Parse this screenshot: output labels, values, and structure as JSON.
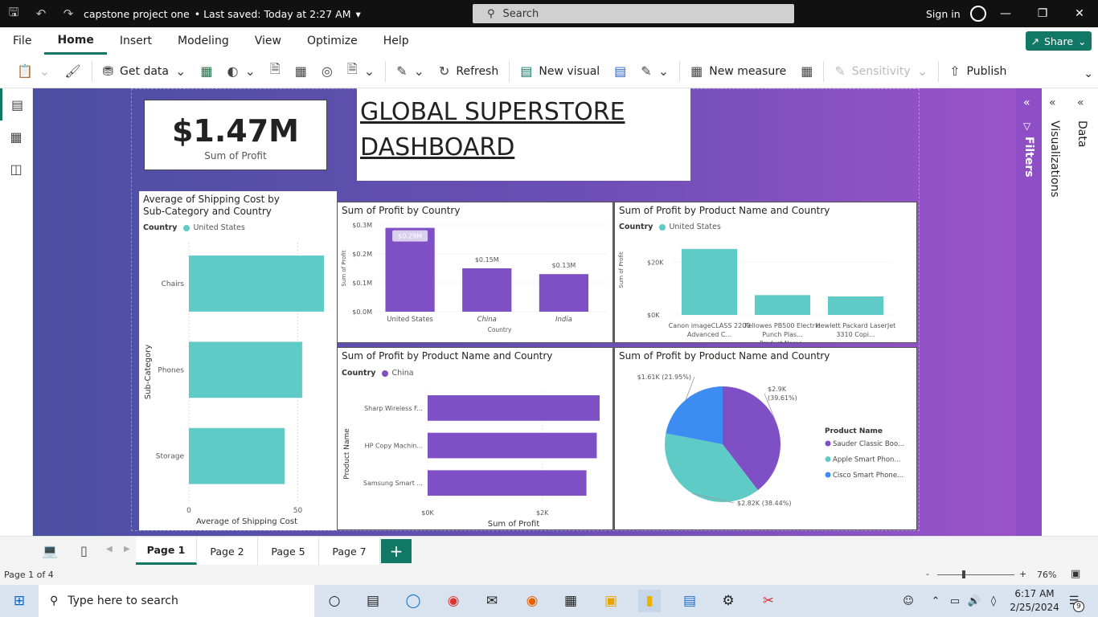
{
  "titlebar": {
    "title": "capstone project one",
    "saved": "• Last saved: Today at 2:27 AM",
    "search": "Search",
    "signin": "Sign in"
  },
  "menu": {
    "items": [
      "File",
      "Home",
      "Insert",
      "Modeling",
      "View",
      "Optimize",
      "Help"
    ],
    "share": "Share"
  },
  "ribbon": {
    "get_data": "Get data",
    "refresh": "Refresh",
    "new_visual": "New visual",
    "new_measure": "New measure",
    "sensitivity": "Sensitivity",
    "publish": "Publish"
  },
  "kpi": {
    "value": "$1.47M",
    "label": "Sum of Profit"
  },
  "dashboard_title": {
    "line1": "GLOBAL SUPERSTORE",
    "line2": "DASHBOARD"
  },
  "colors": {
    "teal": "#5ecbc7",
    "purple": "#7f4fc6",
    "blue": "#3c8cf2",
    "brand": "#117865"
  },
  "chart_data": [
    {
      "id": "shipping",
      "type": "bar",
      "orientation": "horizontal",
      "title": "Average of Shipping Cost by Sub-Category and Country",
      "legend_title": "Country",
      "series": [
        {
          "name": "United States",
          "values": [
            62,
            52,
            44
          ]
        }
      ],
      "categories": [
        "Chairs",
        "Phones",
        "Storage"
      ],
      "xlabel": "Average of Shipping Cost",
      "ylabel": "Sub-Category",
      "xticks": [
        "0",
        "50"
      ],
      "xlim": [
        0,
        62
      ]
    },
    {
      "id": "profit_country",
      "type": "bar",
      "title": "Sum of Profit by Country",
      "categories": [
        "United States",
        "China",
        "India"
      ],
      "values": [
        0.29,
        0.15,
        0.13
      ],
      "data_labels": [
        "$0.29M",
        "$0.15M",
        "$0.13M"
      ],
      "xlabel": "Country",
      "ylabel": "Sum of Profit",
      "yticks": [
        "$0.0M",
        "$0.1M",
        "$0.2M",
        "$0.3M"
      ],
      "ylim": [
        0,
        0.3
      ]
    },
    {
      "id": "profit_product_us",
      "type": "bar",
      "title": "Sum of Profit by Product Name and Country",
      "legend_title": "Country",
      "series": [
        {
          "name": "United States",
          "values": [
            25,
            7.5,
            7
          ]
        }
      ],
      "categories": [
        "Canon imageCLASS 2200 Advanced C...",
        "Fellowes PB500 Electric Punch Plas...",
        "Hewlett Packard LaserJet 3310 Copi..."
      ],
      "xlabel": "Product Name",
      "ylabel": "Sum of Profit",
      "yticks": [
        "$0K",
        "$20K"
      ],
      "ylim": [
        0,
        28
      ]
    },
    {
      "id": "profit_product_china",
      "type": "bar",
      "orientation": "horizontal",
      "title": "Sum of Profit by Product Name and Country",
      "legend_title": "Country",
      "series": [
        {
          "name": "China",
          "values": [
            3.0,
            2.95,
            2.77
          ]
        }
      ],
      "categories": [
        "Sharp Wireless F...",
        "HP Copy Machin...",
        "Samsung Smart ..."
      ],
      "xlabel": "Sum of Profit",
      "ylabel": "Product Name",
      "xticks": [
        "$0K",
        "$2K"
      ],
      "xlim": [
        0,
        3.0
      ]
    },
    {
      "id": "profit_pie",
      "type": "pie",
      "title": "Sum of Profit by Product Name and Country",
      "legend_title": "Product Name",
      "categories": [
        "Sauder Classic Boo...",
        "Apple Smart Phon...",
        "Cisco Smart Phone..."
      ],
      "values": [
        2.9,
        2.82,
        1.61
      ],
      "data_labels": [
        "$2.9K (39.61%)",
        "$2.82K (38.44%)",
        "$1.61K (21.95%)"
      ]
    }
  ],
  "panes": {
    "filters": "Filters",
    "visualizations": "Visualizations",
    "data": "Data"
  },
  "pages": {
    "tabs": [
      "Page 1",
      "Page 2",
      "Page 5",
      "Page 7"
    ],
    "status": "Page 1 of 4",
    "zoom": "76%"
  },
  "taskbar": {
    "search": "Type here to search",
    "time": "6:17 AM",
    "date": "2/25/2024",
    "notif": "9"
  }
}
